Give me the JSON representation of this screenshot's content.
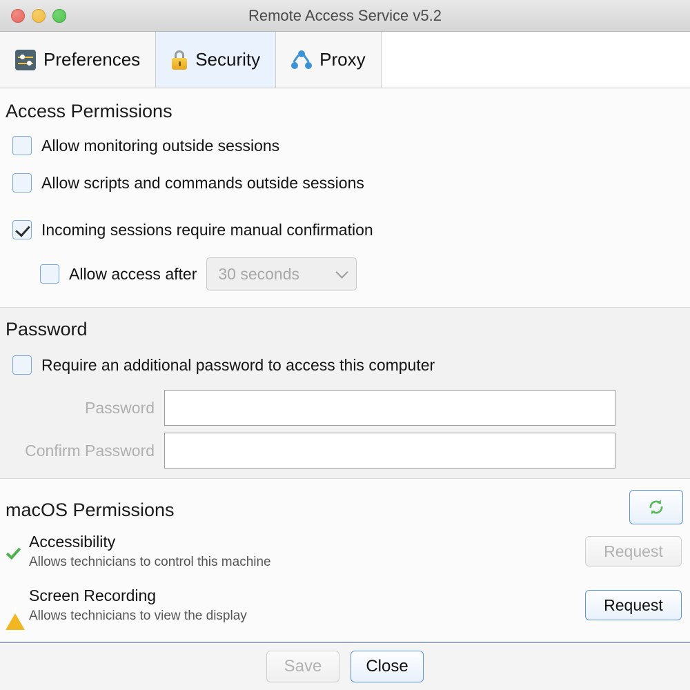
{
  "window": {
    "title": "Remote Access Service v5.2",
    "traffic_lights": [
      {
        "name": "close",
        "color": "#e8685e"
      },
      {
        "name": "minimize",
        "color": "#f1bb41"
      },
      {
        "name": "zoom",
        "color": "#4ec44e"
      }
    ]
  },
  "tabs": [
    {
      "label": "Preferences",
      "icon": "sliders-icon",
      "active": false
    },
    {
      "label": "Security",
      "icon": "lock-icon",
      "active": true
    },
    {
      "label": "Proxy",
      "icon": "network-nodes-icon",
      "active": false
    }
  ],
  "access_permissions": {
    "title": "Access Permissions",
    "checkboxes": [
      {
        "label": "Allow monitoring outside sessions",
        "checked": false
      },
      {
        "label": "Allow scripts and commands outside sessions",
        "checked": false
      },
      {
        "label": "Incoming sessions require manual confirmation",
        "checked": true
      }
    ],
    "allow_after": {
      "label": "Allow access after",
      "checked": false,
      "select_value": "30 seconds",
      "select_disabled": true
    }
  },
  "password": {
    "title": "Password",
    "require_checkbox": {
      "label": "Require an additional password to access this computer",
      "checked": false
    },
    "fields": [
      {
        "label": "Password",
        "value": "",
        "disabled": true
      },
      {
        "label": "Confirm Password",
        "value": "",
        "disabled": true
      }
    ]
  },
  "macos_permissions": {
    "title": "macOS Permissions",
    "refresh_icon": "refresh-icon",
    "items": [
      {
        "status": "granted",
        "status_icon": "check-icon",
        "name": "Accessibility",
        "description": "Allows technicians to control this machine",
        "button_label": "Request",
        "button_disabled": true
      },
      {
        "status": "warning",
        "status_icon": "warning-triangle-icon",
        "name": "Screen Recording",
        "description": "Allows technicians to view the display",
        "button_label": "Request",
        "button_disabled": false
      }
    ]
  },
  "footer": {
    "save_label": "Save",
    "save_disabled": true,
    "close_label": "Close",
    "close_disabled": false
  },
  "colors": {
    "accent_blue": "#5a94de",
    "granted_green": "#4fb04f",
    "warning_yellow": "#f0b722",
    "lock_gold": "#e9a81f",
    "proxy_blue": "#3b93d6"
  }
}
